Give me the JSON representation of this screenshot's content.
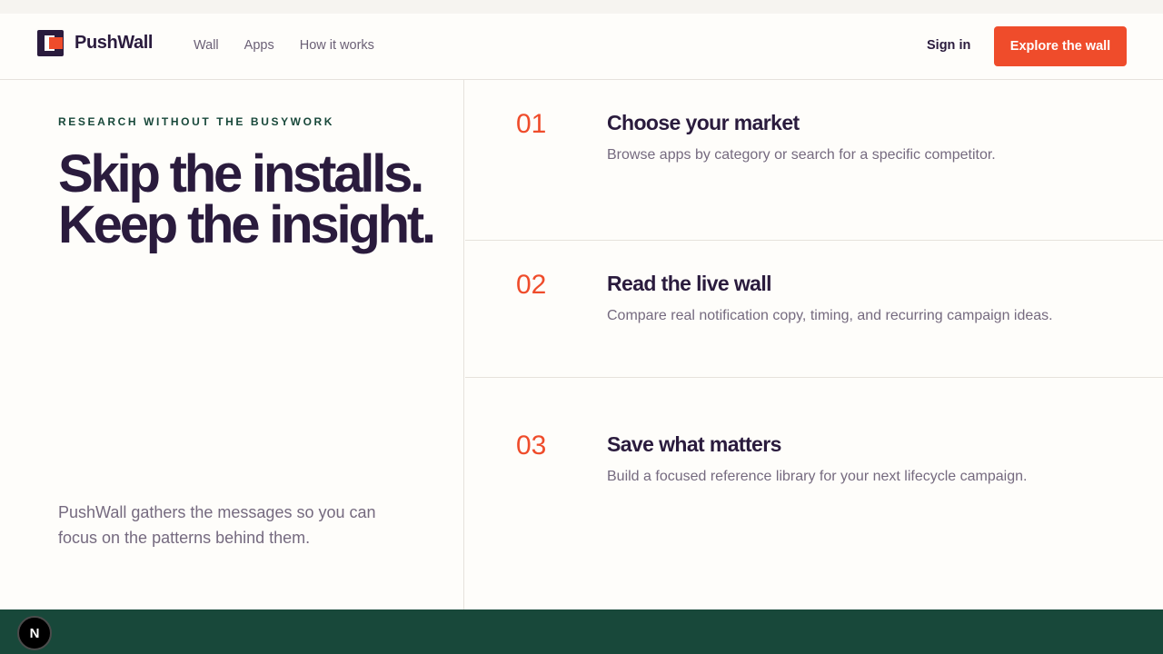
{
  "brand": {
    "name": "PushWall",
    "colors": {
      "accent": "#ef4c2b",
      "ink": "#2a1b3d",
      "forest": "#18483a",
      "muted": "#756a7f"
    }
  },
  "nav": {
    "items": [
      {
        "label": "Wall"
      },
      {
        "label": "Apps"
      },
      {
        "label": "How it works"
      }
    ],
    "sign_in": "Sign in",
    "cta": "Explore the wall"
  },
  "hero": {
    "eyebrow": "RESEARCH WITHOUT THE BUSYWORK",
    "headline_line1": "Skip the installs.",
    "headline_line2": "Keep the insight.",
    "lede": "PushWall gathers the messages so you can focus on the patterns behind them."
  },
  "steps": [
    {
      "num": "01",
      "title": "Choose your market",
      "desc": "Browse apps by category or search for a specific competitor."
    },
    {
      "num": "02",
      "title": "Read the live wall",
      "desc": "Compare real notification copy, timing, and recurring campaign ideas."
    },
    {
      "num": "03",
      "title": "Save what matters",
      "desc": "Build a focused reference library for your next lifecycle campaign."
    }
  ],
  "dev_badge": {
    "letter": "N",
    "icon": "nextjs-icon"
  }
}
